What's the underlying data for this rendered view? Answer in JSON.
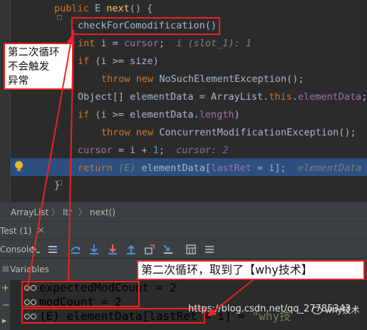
{
  "editor": {
    "lines": [
      {
        "kw": "public",
        "type": "E",
        "name": "next",
        "rest": "() {"
      },
      {
        "code": "checkForComodification();"
      },
      {
        "kw": "int",
        "code": "i = ",
        "field": "cursor",
        "tail": ";",
        "hint": "i (slot_1): 1"
      },
      {
        "kw": "if",
        "code": "(i >= size)"
      },
      {
        "kw": "throw",
        "kw2": "new",
        "code": "NoSuchElementException();"
      },
      {
        "code": "Object[] elementData = ArrayList.",
        "kw": "this",
        "dot": ".",
        "field": "elementData",
        "tail": ";"
      },
      {
        "kw": "if",
        "code": "(i >= elementData.",
        "field": "length",
        "tail": ")"
      },
      {
        "kw": "throw",
        "kw2": "new",
        "code": "ConcurrentModificationException();"
      },
      {
        "field": "cursor",
        "code": " = i + ",
        "num": "1",
        "tail": ";",
        "hint_label": "cursor:",
        "hint_value": "2"
      },
      {
        "kw": "return",
        "cast": "(E)",
        "code": "elementData[",
        "field": "lastRet",
        "tail": " = i];",
        "hint": "elementData ("
      },
      {
        "code": "}"
      }
    ]
  },
  "annotations": {
    "note1": [
      "第二次循环",
      "不会触发",
      "异常"
    ],
    "note2": "第二次循环，取到了【why技术】"
  },
  "breadcrumb": [
    "ArrayList",
    "Itr",
    "next()"
  ],
  "debug": {
    "tab": "Test (1)",
    "toolbar_label": "Console",
    "vars_title": "Variables",
    "variables": [
      {
        "name": "expectedModCount",
        "value": "2"
      },
      {
        "name": "modCount",
        "value": "2"
      },
      {
        "name": "(E) elementData[lastRet = i]",
        "value": "\"why技"
      }
    ]
  },
  "watermark": "https://blog.csdn.net/qq_27785343",
  "logo": "why技术",
  "colors": {
    "exec_line": "#2d4f80",
    "annotation_red": "#ee2222",
    "keyword": "#cc7832",
    "field": "#9876aa"
  }
}
